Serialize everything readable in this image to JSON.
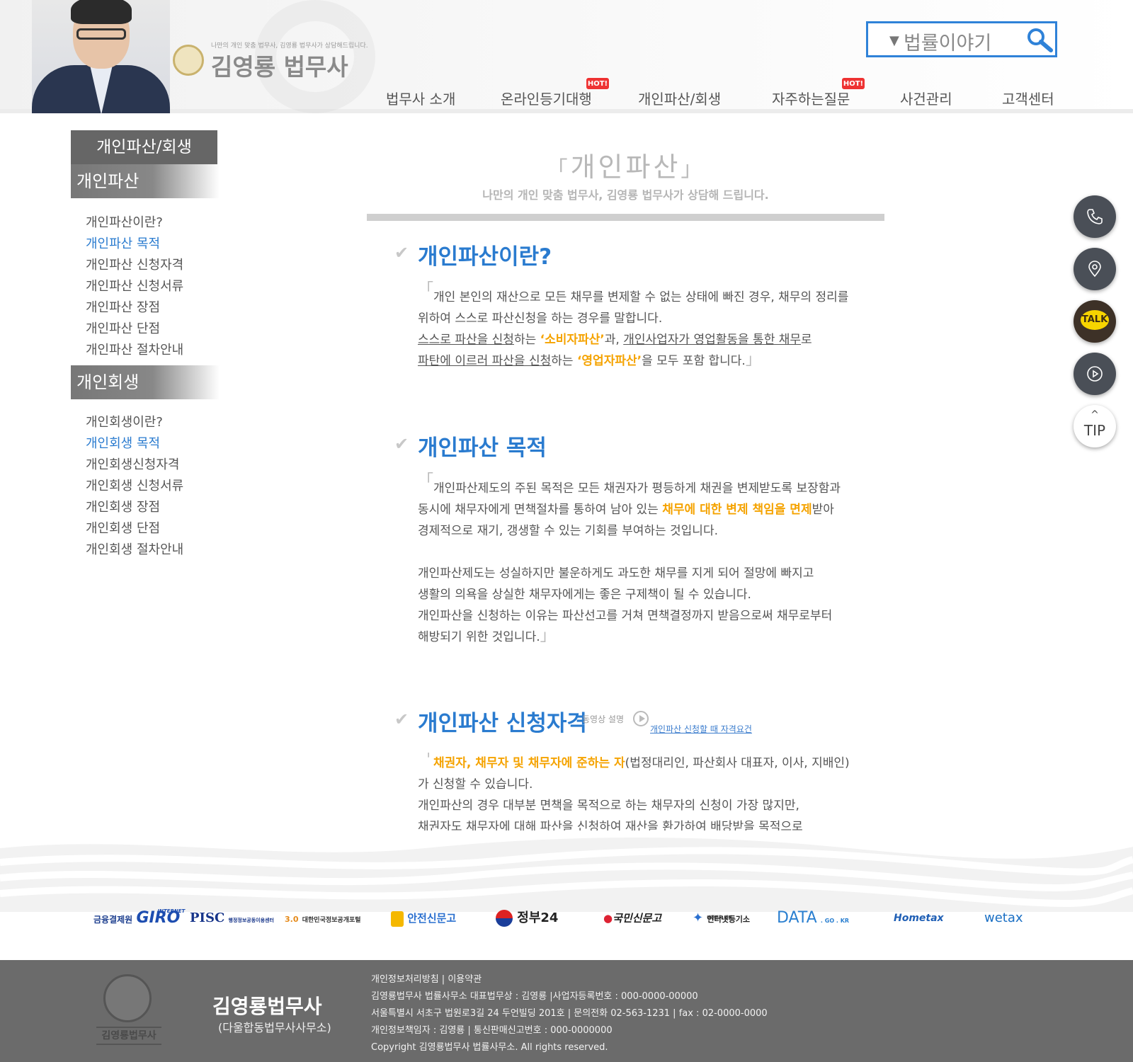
{
  "header": {
    "brand_sub": "나만의 개인 맞춤 법무사, 김영룡 법무사가 상담해드립니다.",
    "brand_name": "김영룡 법무사",
    "search_value": "법률이야기",
    "hot_badge": "HOT!",
    "nav": [
      "법무사 소개",
      "온라인등기대행",
      "개인파산/회생",
      "자주하는질문",
      "사건관리",
      "고객센터"
    ]
  },
  "sidebar": {
    "title": "개인파산/회생",
    "bankruptcy": {
      "category": "개인파산",
      "links": [
        "개인파산이란?",
        "개인파산 목적",
        "개인파산 신청자격",
        "개인파산 신청서류",
        "개인파산 장점",
        "개인파산 단점",
        "개인파산 절차안내"
      ]
    },
    "rehab": {
      "category": "개인회생",
      "links": [
        "개인회생이란?",
        "개인회생 목적",
        "개인회생신청자격",
        "개인회생 신청서류",
        "개인회생 장점",
        "개인회생 단점",
        "개인회생 절차안내"
      ]
    }
  },
  "main": {
    "page_title": "개인파산",
    "page_subtitle": "나만의 개인 맞춤 법무사, 김영룡 법무사가 상담해 드립니다.",
    "s1": {
      "title": "개인파산이란?",
      "t1": "개인 본인의 재산으로 모든 채무를 변제할 수 없는 상태에 빠진 경우, 채무의 정리를",
      "t2": "위하여 스스로 파산신청을 하는 경우를 말합니다.",
      "t3a": "스스로 파산을 신청",
      "t3b": "하는 ",
      "t3c": "‘소비자파산’",
      "t3d": "과, ",
      "t3e": "개인사업자가 영업활동을 통한 채무",
      "t3f": "로",
      "t4a": "파탄에 이르러 파산을 신청",
      "t4b": "하는 ",
      "t4c": "‘영업자파산’",
      "t4d": "을 모두 포함 합니다."
    },
    "s2": {
      "title": "개인파산 목적",
      "t1": "개인파산제도의 주된 목적은 모든 채권자가 평등하게 채권을 변제받도록 보장함과",
      "t2a": "동시에 채무자에게 면책절차를 통하여 남아 있는 ",
      "t2b": "채무에 대한 변제 책임을 면제",
      "t2c": "받아",
      "t3": "경제적으로 재기, 갱생할 수 있는 기회를 부여하는 것입니다.",
      "t4": "개인파산제도는 성실하지만 불운하게도 과도한 채무를 지게 되어 절망에 빠지고",
      "t5": "생활의 의욕을 상실한 채무자에게는 좋은 구제책이 될 수 있습니다.",
      "t6": "개인파산을 신청하는 이유는 파산선고를 거쳐 면책결정까지 받음으로써 채무로부터",
      "t7": "해방되기 위한 것입니다."
    },
    "s3": {
      "title": "개인파산 신청자격",
      "video_label": "동영상 설명",
      "video_link": "개인파산 신청할 때 자격요건",
      "t1a": "채권자, 채무자 및 채무자에 준하는 자",
      "t1b": "(법정대리인, 파산회사 대표자, 이사, 지배인)",
      "t2": "가 신청할 수 있습니다.",
      "t3": "개인파산의 경우 대부분 면책을 목적으로 하는 채무자의 신청이 가장 많지만,",
      "t4": "채권자도 채무자에 대해 파산을 신청하여 재산을 환가하여 배당받을 목적으로"
    }
  },
  "quick": {
    "talk": "TALK",
    "tip": "TIP",
    "tip_caret": "^"
  },
  "banners": {
    "giro_prefix": "금융결제원",
    "giro_super": "INTERNET",
    "giro": "GIRO",
    "pisc": "PISC",
    "pisc_sub": "행정정보공동이용센터",
    "gov30_num": "3.0",
    "gov30": "대한민국정보공개포털",
    "safety": "안전신문고",
    "gov24": "정부24",
    "sinmungo": "국민신문고",
    "iros_sub": "대한민국 법원",
    "iros": "인터넷등기소",
    "data": "DATA",
    "data_sub": ". GO . KR",
    "hometax": "Hometax",
    "wetax": "wetax"
  },
  "footer": {
    "seal_label": "김영룡법무사",
    "name": "김영룡법무사",
    "name_sub": "(다울합동법무사사무소)",
    "lines": [
      "개인정보처리방침 | 이용약관",
      "김영룡법무사 법률사무소  대표법무상 : 김영룡  |사업자등록번호 : 000-0000-00000",
      "서울특별시 서초구 법원로3길 24 두언빌딩 201호 | 문의전화 02-563-1231 | fax : 02-0000-0000",
      "개인정보책임자 : 김영룡  | 통신판매신고번호 : 000-0000000",
      "Copyright 김영룡법무사 법률사무소. All rights reserved."
    ]
  },
  "colors": {
    "accent": "#2a7bcf",
    "highlight": "#f5a300",
    "footer_bg": "#6b6b6b",
    "hot": "#e33333"
  }
}
